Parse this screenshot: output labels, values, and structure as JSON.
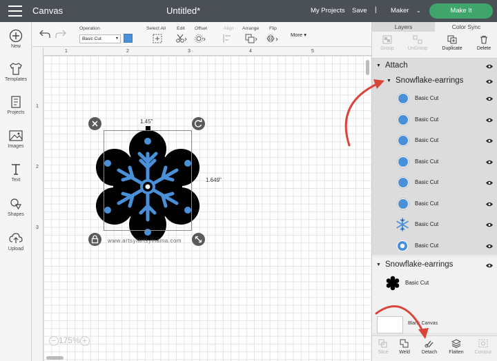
{
  "topbar": {
    "app_title": "Canvas",
    "doc_title": "Untitled*",
    "my_projects": "My Projects",
    "save": "Save",
    "separator": "|",
    "machine": "Maker",
    "make_it": "Make It"
  },
  "sidebar": {
    "items": [
      {
        "label": "New",
        "icon": "plus-icon"
      },
      {
        "label": "Templates",
        "icon": "shirt-icon"
      },
      {
        "label": "Projects",
        "icon": "projects-icon"
      },
      {
        "label": "Images",
        "icon": "image-icon"
      },
      {
        "label": "Text",
        "icon": "text-icon"
      },
      {
        "label": "Shapes",
        "icon": "shapes-icon"
      },
      {
        "label": "Upload",
        "icon": "upload-icon"
      }
    ]
  },
  "toolbar": {
    "operation_label": "Operation",
    "operation_value": "Basic Cut",
    "operation_color": "#4a90d9",
    "select_all": "Select All",
    "edit": "Edit",
    "offset": "Offset",
    "align": "Align",
    "arrange": "Arrange",
    "flip": "Flip",
    "more": "More"
  },
  "canvas": {
    "ruler_top": [
      "1",
      "2",
      "3",
      "4",
      "5"
    ],
    "ruler_left": [
      "1",
      "2",
      "3"
    ],
    "width_label": "1.45\"",
    "height_label": "1.649\"",
    "watermark": "www.artsyfartsymama.com",
    "zoom": "175%",
    "zoom_minus": "−",
    "zoom_plus": "+",
    "object_fill": "#000000",
    "snowflake_color": "#4a90d9"
  },
  "right_panel": {
    "tabs": [
      "Layers",
      "Color Sync"
    ],
    "tools": [
      {
        "label": "Group",
        "enabled": false
      },
      {
        "label": "UnGroup",
        "enabled": false
      },
      {
        "label": "Duplicate",
        "enabled": true
      },
      {
        "label": "Delete",
        "enabled": true
      }
    ],
    "attach_group": "Attach",
    "subgroup_1": "Snowflake-earrings",
    "layers_1": [
      {
        "name": "Basic Cut",
        "thumb": "dot"
      },
      {
        "name": "Basic Cut",
        "thumb": "dot"
      },
      {
        "name": "Basic Cut",
        "thumb": "dot"
      },
      {
        "name": "Basic Cut",
        "thumb": "dot"
      },
      {
        "name": "Basic Cut",
        "thumb": "dot"
      },
      {
        "name": "Basic Cut",
        "thumb": "dot"
      },
      {
        "name": "Basic Cut",
        "thumb": "snowflake"
      },
      {
        "name": "Basic Cut",
        "thumb": "ring"
      }
    ],
    "group_2": "Snowflake-earrings",
    "layers_2": [
      {
        "name": "Basic Cut",
        "thumb": "black-star"
      }
    ],
    "blank_canvas": "Blank Canvas",
    "bottom_tools": [
      {
        "label": "Slice",
        "enabled": false
      },
      {
        "label": "Weld",
        "enabled": true
      },
      {
        "label": "Detach",
        "enabled": true
      },
      {
        "label": "Flatten",
        "enabled": true
      },
      {
        "label": "Contour",
        "enabled": false
      }
    ],
    "arrow_color": "#d9453a"
  }
}
